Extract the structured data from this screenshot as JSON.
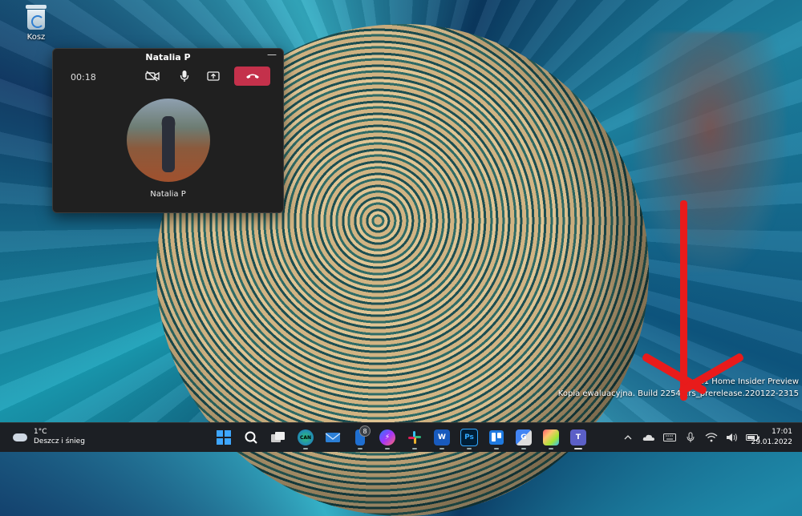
{
  "desktop": {
    "recycle_bin_label": "Kosz"
  },
  "call_window": {
    "title": "Natalia P",
    "minimize_glyph": "—",
    "timer": "00:18",
    "caller_name": "Natalia P",
    "controls": [
      "camera-off-icon",
      "microphone-icon",
      "share-screen-icon",
      "hang-up-icon"
    ],
    "hang_up_color": "#c4314b"
  },
  "watermark": {
    "line1": "ws 11 Home Insider Preview",
    "line2": "Kopia ewaluacyjna. Build 22543.rs_prerelease.220122-2315"
  },
  "annotation": {
    "arrow_color": "#e81b1b"
  },
  "taskbar": {
    "weather": {
      "temperature": "1°C",
      "condition": "Deszcz i śnieg"
    },
    "apps": [
      {
        "name": "start-icon"
      },
      {
        "name": "search-icon"
      },
      {
        "name": "task-view-icon"
      },
      {
        "name": "edge-canary-icon",
        "label": "CAN"
      },
      {
        "name": "mail-icon"
      },
      {
        "name": "phone-link-icon",
        "badge": "8"
      },
      {
        "name": "messenger-icon"
      },
      {
        "name": "slack-icon"
      },
      {
        "name": "word-icon",
        "label": "W"
      },
      {
        "name": "photoshop-icon",
        "label": "Ps"
      },
      {
        "name": "trello-icon"
      },
      {
        "name": "translate-icon"
      },
      {
        "name": "paint-icon"
      },
      {
        "name": "teams-icon",
        "label": "T"
      }
    ],
    "tray": [
      "chevron-up-icon",
      "onedrive-icon",
      "keyboard-icon",
      "microphone-icon",
      "wifi-icon",
      "volume-icon",
      "battery-icon"
    ],
    "clock": {
      "time": "17:01",
      "date": "29.01.2022"
    }
  }
}
